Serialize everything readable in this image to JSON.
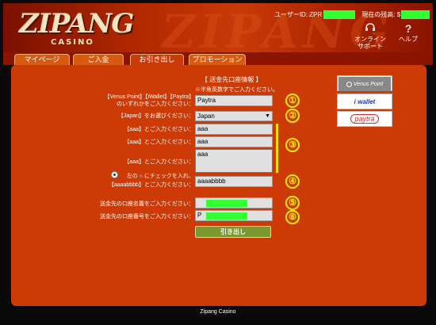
{
  "header": {
    "watermark": "ZIPANG",
    "logo_main": "ZIPANG",
    "logo_sub": "CASINO",
    "user_id_label": "ユーザーID: ZPR",
    "balance_label": "現在の残高: $",
    "support_label": "オンライン\nサポート",
    "help_label": "ヘルプ"
  },
  "tabs": [
    {
      "label": "マイページ",
      "active": false
    },
    {
      "label": "ご入金",
      "active": false
    },
    {
      "label": "お引き出し",
      "active": true
    },
    {
      "label": "プロモーション",
      "active": false
    }
  ],
  "form": {
    "section_title": "【 送金先口座情報 】",
    "note": "※半角英数字でご入力ください。",
    "wallet_label_1": "【Venus Point】【iWallet】【Paytra】",
    "wallet_label_2": "のいずれかをご入力ください：",
    "wallet_value": "Paytra",
    "country_label": "【Japan】をお選びください：",
    "country_value": "Japan",
    "aaa_label": "【aaa】とご入力ください：",
    "aaa_value_1": "aaa",
    "aaa_value_2": "aaa",
    "aaa_value_3": "aaa",
    "radio_label_1": "左の ○ にチェックを入れ、",
    "radio_label_2": "【aaaabbbb】とご入力ください：",
    "radio_value": "aaaabbbb",
    "account_name_label": "送金先の口座名義をご入力ください：",
    "account_number_label": "送金先の口座番号をご入力ください：",
    "account_number_prefix": "P",
    "submit_label": "引き出し",
    "markers": [
      "①",
      "②",
      "③",
      "④",
      "⑤",
      "⑥"
    ]
  },
  "payment_logos": [
    {
      "name": "Venus Point"
    },
    {
      "name": "i wallet"
    },
    {
      "name": "paytra"
    }
  ],
  "footer": {
    "text": "Zipang Casino"
  },
  "colors": {
    "accent": "#cc3a06",
    "marker": "#fff000",
    "redaction": "#33ff33",
    "button": "#7a9a30"
  }
}
